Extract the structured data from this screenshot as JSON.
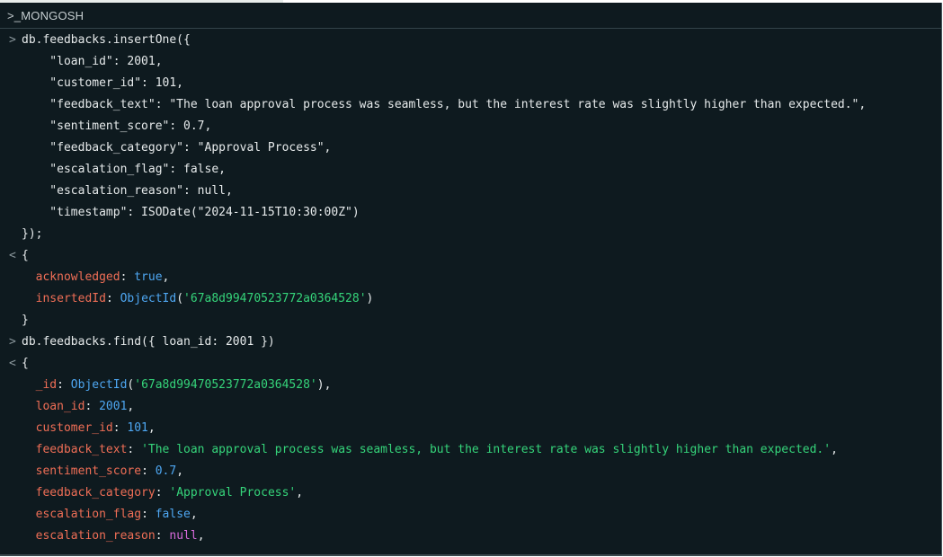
{
  "header": {
    "title": ">_MONGOSH"
  },
  "command1": {
    "prompt": ">",
    "lines": [
      "db.feedbacks.insertOne({",
      "    \"loan_id\": 2001,",
      "    \"customer_id\": 101,",
      "    \"feedback_text\": \"The loan approval process was seamless, but the interest rate was slightly higher than expected.\",",
      "    \"sentiment_score\": 0.7,",
      "    \"feedback_category\": \"Approval Process\",",
      "    \"escalation_flag\": false,",
      "    \"escalation_reason\": null,",
      "    \"timestamp\": ISODate(\"2024-11-15T10:30:00Z\")",
      "});"
    ]
  },
  "result1": {
    "marker": "<",
    "open": "{",
    "acknowledged_key": "acknowledged",
    "acknowledged_value": "true",
    "insertedId_key": "insertedId",
    "objectid_fn": "ObjectId",
    "objectid_value": "'67a8d99470523772a0364528'",
    "close": "}"
  },
  "command2": {
    "prompt": ">",
    "text": "db.feedbacks.find({ loan_id: 2001 })"
  },
  "result2": {
    "marker": "<",
    "open": "{",
    "fields": {
      "id_key": "_id",
      "id_fn": "ObjectId",
      "id_value": "'67a8d99470523772a0364528'",
      "loan_id_key": "loan_id",
      "loan_id_value": "2001",
      "customer_id_key": "customer_id",
      "customer_id_value": "101",
      "feedback_text_key": "feedback_text",
      "feedback_text_value": "'The loan approval process was seamless, but the interest rate was slightly higher than expected.'",
      "sentiment_score_key": "sentiment_score",
      "sentiment_score_value": "0.7",
      "feedback_category_key": "feedback_category",
      "feedback_category_value": "'Approval Process'",
      "escalation_flag_key": "escalation_flag",
      "escalation_flag_value": "false",
      "escalation_reason_key": "escalation_reason",
      "escalation_reason_value": "null"
    }
  },
  "colors": {
    "background": "#0e1a1f",
    "key": "#ef6e56",
    "string": "#35d47a",
    "number": "#4ea7f2",
    "null": "#d66adb",
    "text": "#e6eaeb"
  }
}
